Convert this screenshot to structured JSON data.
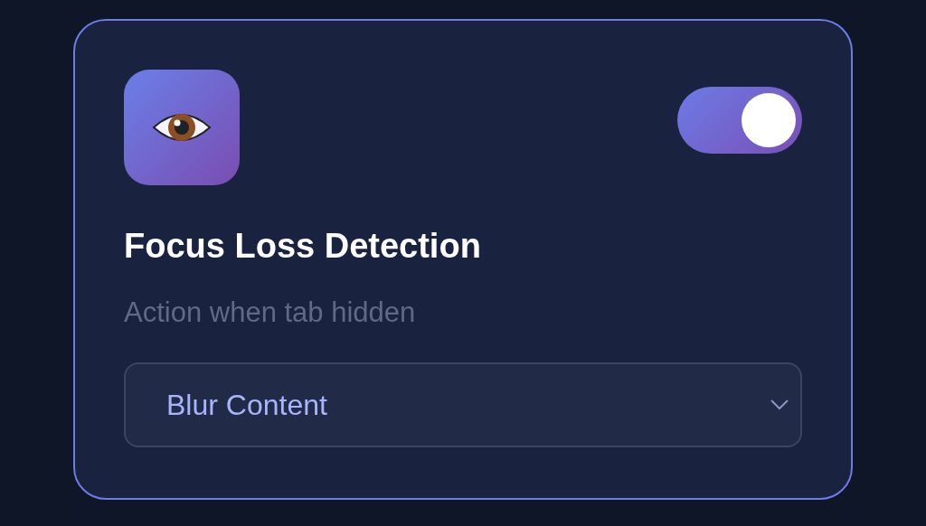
{
  "card": {
    "title": "Focus Loss Detection",
    "enabled": true,
    "label": "Action when tab hidden",
    "value": "Blur Content"
  }
}
